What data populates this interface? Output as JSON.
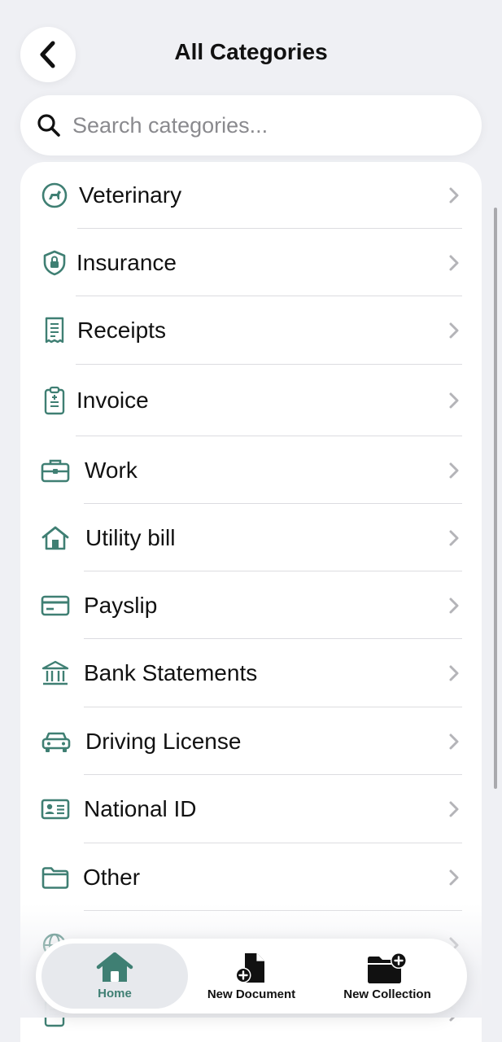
{
  "header": {
    "title": "All Categories"
  },
  "search": {
    "placeholder": "Search categories..."
  },
  "categories": [
    {
      "label": "Veterinary",
      "icon": "pet-icon"
    },
    {
      "label": "Insurance",
      "icon": "shield-lock-icon"
    },
    {
      "label": "Receipts",
      "icon": "receipt-icon"
    },
    {
      "label": "Invoice",
      "icon": "invoice-clipboard-icon"
    },
    {
      "label": "Work",
      "icon": "briefcase-icon"
    },
    {
      "label": "Utility bill",
      "icon": "house-icon"
    },
    {
      "label": "Payslip",
      "icon": "card-icon"
    },
    {
      "label": "Bank Statements",
      "icon": "bank-icon"
    },
    {
      "label": "Driving License",
      "icon": "car-icon"
    },
    {
      "label": "National ID",
      "icon": "id-card-icon"
    },
    {
      "label": "Other",
      "icon": "folder-icon"
    },
    {
      "label": "",
      "icon": "globe-icon"
    },
    {
      "label": "",
      "icon": "document-icon"
    }
  ],
  "tabbar": {
    "home": "Home",
    "new_document": "New Document",
    "new_collection": "New Collection"
  },
  "colors": {
    "accent": "#3f7f73",
    "background": "#eff0f4",
    "chevron": "#b4b4b8"
  }
}
